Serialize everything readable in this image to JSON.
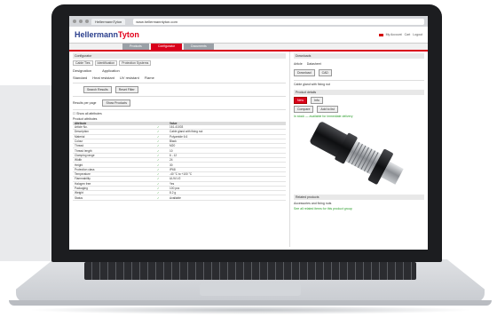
{
  "browser": {
    "tab_label": "HellermannTyton",
    "url": "www.hellermanntyton.com"
  },
  "header": {
    "logo_main": "Hellermann",
    "logo_accent": "Tyton",
    "top_links": [
      "My Account",
      "Cart",
      "Logout"
    ]
  },
  "nav": {
    "tabs": [
      {
        "label": "Products"
      },
      {
        "label": "Configurator",
        "active": true
      },
      {
        "label": "Documents"
      }
    ]
  },
  "left": {
    "section_title": "Configurator",
    "crumbs": [
      "Cable Ties",
      "Identification",
      "Protection Systems"
    ],
    "field_a_label": "Designation",
    "field_b_label": "Application",
    "options": [
      "Standard",
      "Heat resistant",
      "UV resistant",
      "Flame"
    ],
    "btn_search": "Search Results",
    "btn_reset": "Reset Filter",
    "results_label": "Results per page",
    "btn_show": "Show Products",
    "checkbox_label": "Show all attributes",
    "table_title": "Product attributes",
    "table_headers": [
      "Attribute",
      "",
      "Value"
    ],
    "rows": [
      {
        "name": "Article No.",
        "value": "161-41003"
      },
      {
        "name": "Description",
        "value": "Cable gland with fixing nut"
      },
      {
        "name": "Material",
        "value": "Polyamide 6.6"
      },
      {
        "name": "Colour",
        "value": "Black"
      },
      {
        "name": "Thread",
        "value": "M20"
      },
      {
        "name": "Thread length",
        "value": "10"
      },
      {
        "name": "Clamping range",
        "value": "6 - 12"
      },
      {
        "name": "Width",
        "value": "24"
      },
      {
        "name": "Height",
        "value": "30"
      },
      {
        "name": "Protection class",
        "value": "IP68"
      },
      {
        "name": "Temperature",
        "value": "-40 °C to +100 °C"
      },
      {
        "name": "Flammability",
        "value": "UL94 V2"
      },
      {
        "name": "Halogen free",
        "value": "Yes"
      },
      {
        "name": "Packaging",
        "value": "100 pcs"
      },
      {
        "name": "Weight",
        "value": "8.2 g"
      },
      {
        "name": "Status",
        "value": "Available"
      }
    ]
  },
  "right": {
    "section_title": "Downloads",
    "label_a": "Article",
    "label_b": "Datasheet",
    "btn_download": "Download",
    "btn_cad": "CAD",
    "note": "Cable gland with fixing nut",
    "panel_title": "Product details",
    "tag_red": "New",
    "tag_gray": "Info",
    "btn_compare": "Compare",
    "btn_add": "Add to list",
    "green_text": "In stock — available for immediate delivery",
    "footer_title": "Related products",
    "footer_line1": "Accessories and fixing nuts",
    "footer_line2": "See all related items for this product group"
  },
  "checkmark_symbol": "✓",
  "colors": {
    "brand_red": "#d9001b",
    "brand_blue": "#2a3e8c",
    "check_green": "#2a9d2a"
  }
}
